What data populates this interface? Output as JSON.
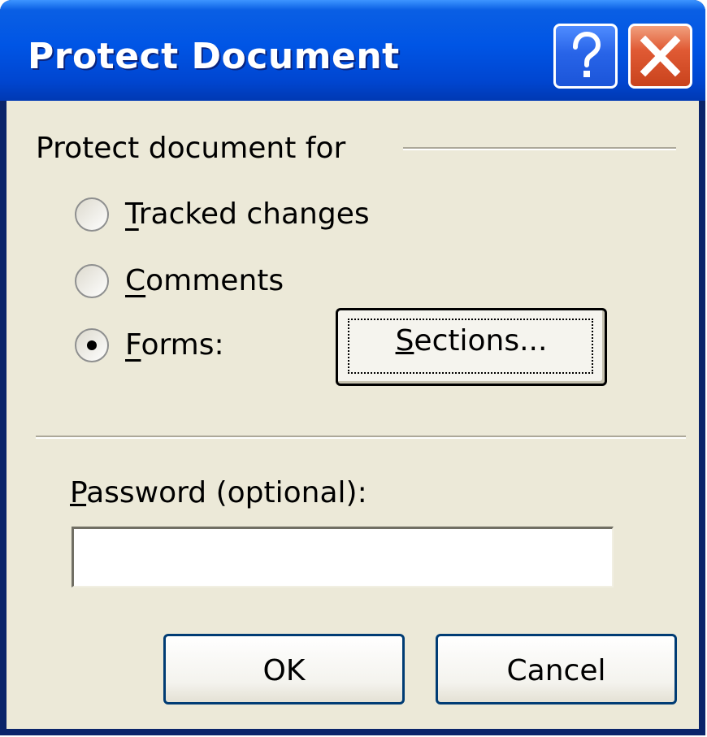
{
  "window": {
    "title": "Protect Document"
  },
  "titlebar_buttons": {
    "help_icon": "question-mark",
    "close_icon": "x"
  },
  "group": {
    "label": "Protect document for",
    "options": [
      {
        "label": "Tracked changes",
        "underline": "T",
        "rest": "racked changes",
        "selected": false
      },
      {
        "label": "Comments",
        "underline": "C",
        "rest": "omments",
        "selected": false
      },
      {
        "label": "Forms:",
        "underline": "F",
        "rest": "orms:",
        "selected": true
      }
    ]
  },
  "sections_button": {
    "label": "Sections...",
    "underline": "S",
    "rest": "ections..."
  },
  "password": {
    "label": "Password (optional):",
    "underline": "P",
    "rest": "assword (optional):",
    "value": ""
  },
  "buttons": {
    "ok": "OK",
    "cancel": "Cancel"
  },
  "colors": {
    "titlebar": "#0055e5",
    "dialog_bg": "#ece9d8",
    "close_button": "#e05a34",
    "help_button": "#2864e8"
  }
}
